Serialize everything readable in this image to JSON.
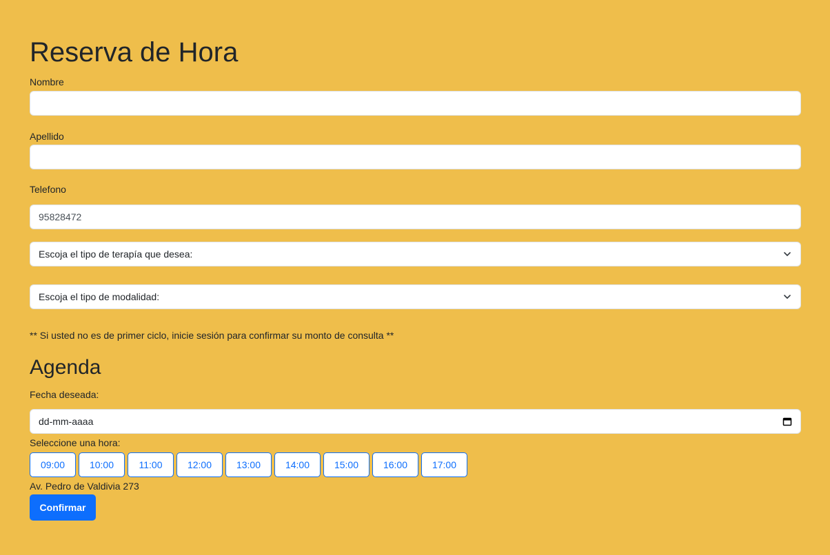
{
  "page": {
    "title": "Reserva de Hora",
    "background_color": "#efbe4b",
    "accent_color": "#0d6efd"
  },
  "form": {
    "nombre_label": "Nombre",
    "nombre_value": "",
    "apellido_label": "Apellido",
    "apellido_value": "",
    "telefono_label": "Telefono",
    "telefono_value": "95828472",
    "terapia_select": "Escoja el tipo de terapía que desea:",
    "modalidad_select": "Escoja el tipo de modalidad:",
    "note": "** Si usted no es de primer ciclo, inicie sesión para confirmar su monto de consulta **"
  },
  "agenda": {
    "title": "Agenda",
    "fecha_label": "Fecha deseada:",
    "fecha_placeholder": "dd-mm-aaaa",
    "hora_label": "Seleccione una hora:",
    "hours": [
      "09:00",
      "10:00",
      "11:00",
      "12:00",
      "13:00",
      "14:00",
      "15:00",
      "16:00",
      "17:00"
    ],
    "address": "Av. Pedro de Valdivia 273",
    "confirm_label": "Confirmar"
  },
  "icons": {
    "select_chevron": "chevron-down-icon",
    "date_picker": "calendar-icon"
  }
}
